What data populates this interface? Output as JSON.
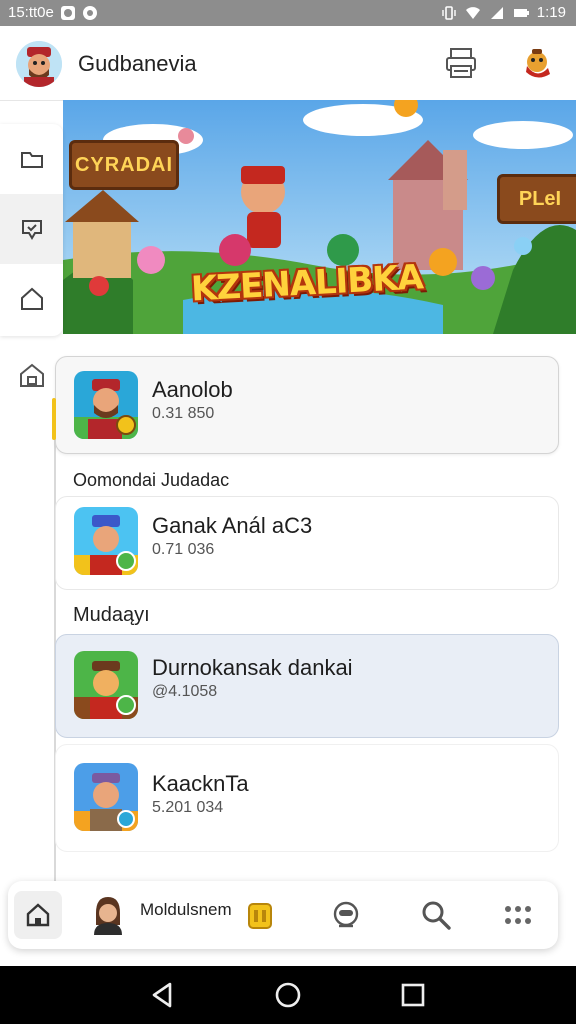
{
  "status_bar": {
    "time_left": "15:tt0e",
    "time_right": "1:19"
  },
  "header": {
    "title": "Gudbanevia"
  },
  "banner": {
    "sign_left": "CYRADAI",
    "sign_right": "PLeI",
    "title": "KZENALIBKA"
  },
  "list": {
    "items": [
      {
        "name": "Aanolob",
        "sub": "0.31 850"
      },
      {
        "name": "Ganak Anál aC3",
        "sub": "0.71 036"
      },
      {
        "name": "Durnokansak dankai",
        "sub": "@4.1058"
      },
      {
        "name": "KaacknTa",
        "sub": "5.201 034"
      }
    ],
    "section_1": "Oomondai Judadac",
    "section_2": "Mudaąyı"
  },
  "bottom_nav": {
    "label": "Moldulsnem"
  },
  "colors": {
    "accent": "#f2c21b",
    "highlight": "#e9eef6",
    "status_bar": "#8d8d8d"
  },
  "icons": [
    "drawer-icon",
    "printer-icon",
    "mascot-icon",
    "folder-icon",
    "chat-shield-icon",
    "home-icon",
    "home-lock-icon",
    "search-icon",
    "more-grid-icon",
    "back-icon",
    "circle-home-icon",
    "recents-icon"
  ]
}
